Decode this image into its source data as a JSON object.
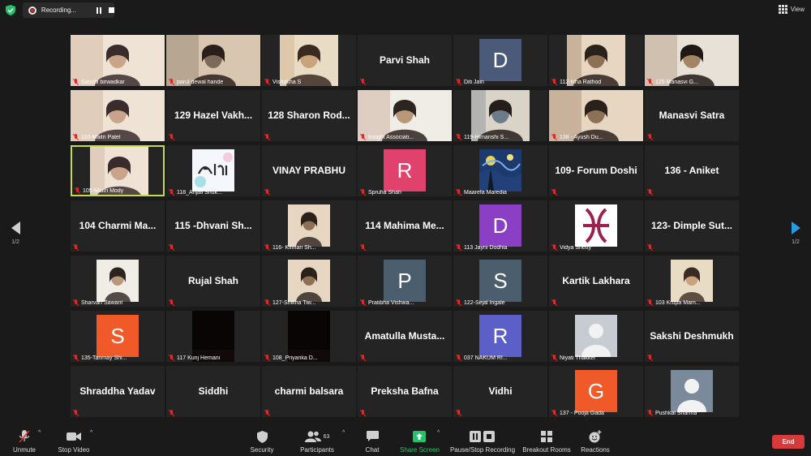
{
  "topbar": {
    "recording_label": "Recording...",
    "view_label": "View"
  },
  "pagination": {
    "left_label": "1/2",
    "right_label": "1/2"
  },
  "colors": {
    "accent_blue": "#2a9be0",
    "active_speaker": "#c6d94d",
    "end_red": "#d63a3a",
    "muted_red": "#e02828",
    "share_green": "#26c16b"
  },
  "tiles": [
    {
      "type": "video",
      "name": "Sanchi birwadkar"
    },
    {
      "type": "video",
      "name": "parul dewal hande"
    },
    {
      "type": "video",
      "name": "Vishakha S"
    },
    {
      "type": "text",
      "big": "Parvi Shah"
    },
    {
      "type": "avatar",
      "letter": "D",
      "color": "#4a5a78",
      "name": "Diti Jain"
    },
    {
      "type": "video",
      "name": "112-Isha Rathod"
    },
    {
      "type": "video",
      "name": "125 Manasvi G..."
    },
    {
      "type": "video",
      "name": "110-Maitri Patel"
    },
    {
      "type": "text",
      "big": "129 Hazel Vakh..."
    },
    {
      "type": "text",
      "big": "128 Sharon Rod..."
    },
    {
      "type": "video",
      "name": "Insight Associati..."
    },
    {
      "type": "video",
      "name": "119-Himanshi S..."
    },
    {
      "type": "video",
      "name": "138 - Ayush Du..."
    },
    {
      "type": "text",
      "big": "Manasvi Satra"
    },
    {
      "type": "video",
      "name": "105-Maitri Mody",
      "active": true
    },
    {
      "type": "image",
      "name": "118_Anjali Shuk..."
    },
    {
      "type": "text",
      "big": "VINAY PRABHU"
    },
    {
      "type": "avatar",
      "letter": "R",
      "color": "#e0416d",
      "name": "Spruha Shah"
    },
    {
      "type": "image",
      "name": "Maarefa Maredia"
    },
    {
      "type": "text",
      "big": "109- Forum Doshi"
    },
    {
      "type": "text",
      "big": "136 - Aniket"
    },
    {
      "type": "text",
      "big": "104 Charmi Ma..."
    },
    {
      "type": "text",
      "big": "115 -Dhvani Sh..."
    },
    {
      "type": "image",
      "name": "116- Kinnari Sh..."
    },
    {
      "type": "text",
      "big": "114 Mahima Me..."
    },
    {
      "type": "avatar",
      "letter": "D",
      "color": "#8a3fc4",
      "name": "113 Jayni Dodhia"
    },
    {
      "type": "image",
      "name": "Vidya Shetty"
    },
    {
      "type": "text",
      "big": "123- Dimple Sut..."
    },
    {
      "type": "image",
      "name": "Sharvari Sawant"
    },
    {
      "type": "text",
      "big": "Rujal Shah"
    },
    {
      "type": "image",
      "name": "127-Shikha Tiw..."
    },
    {
      "type": "avatar",
      "letter": "P",
      "color": "#4b5e6e",
      "name": "Pratibha Vishwa..."
    },
    {
      "type": "avatar",
      "letter": "S",
      "color": "#4b5e6e",
      "name": "122-Sejal Ingale"
    },
    {
      "type": "text",
      "big": "Kartik Lakhara"
    },
    {
      "type": "image",
      "name": "103 Krupa Mam..."
    },
    {
      "type": "avatar",
      "letter": "S",
      "color": "#f05a28",
      "name": "135-Tanmay Shi..."
    },
    {
      "type": "video",
      "name": "117 Kunj Hemani"
    },
    {
      "type": "video",
      "name": "108_Priyanka D..."
    },
    {
      "type": "text",
      "big": "Amatulla  Musta..."
    },
    {
      "type": "avatar",
      "letter": "R",
      "color": "#5b5fc7",
      "name": "037 NAKUM RI..."
    },
    {
      "type": "image",
      "name": "Niyati Thakker"
    },
    {
      "type": "text",
      "big": "Sakshi Deshmukh"
    },
    {
      "type": "text",
      "big": "Shraddha Yadav"
    },
    {
      "type": "text",
      "big": "Siddhi"
    },
    {
      "type": "text",
      "big": "charmi balsara"
    },
    {
      "type": "text",
      "big": "Preksha Bafna"
    },
    {
      "type": "text",
      "big": "Vidhi"
    },
    {
      "type": "avatar",
      "letter": "G",
      "color": "#f05a28",
      "name": "137 - Pooja Gada"
    },
    {
      "type": "image",
      "name": "Pushkal Sharma"
    }
  ],
  "toolbar": {
    "unmute": "Unmute",
    "stop_video": "Stop Video",
    "security": "Security",
    "participants": "Participants",
    "participants_count": "63",
    "chat": "Chat",
    "share_screen": "Share Screen",
    "pause_stop_recording": "Pause/Stop Recording",
    "breakout_rooms": "Breakout Rooms",
    "reactions": "Reactions",
    "end": "End"
  }
}
